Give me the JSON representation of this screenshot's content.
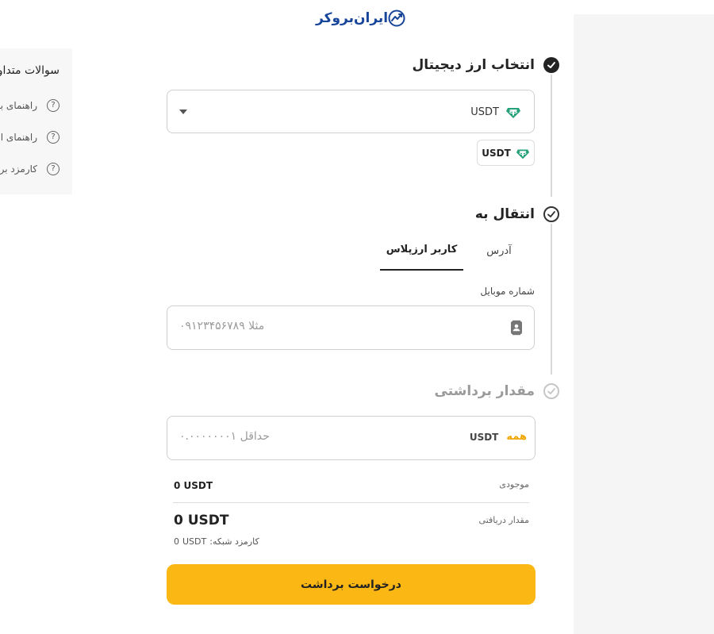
{
  "brand": {
    "logo_text": "ایران‌بروکر"
  },
  "faq": {
    "title": "سوالات متداول",
    "items": [
      {
        "label": "راهنمای برداشت ارز"
      },
      {
        "label": "راهنمای انتقال ارز"
      },
      {
        "label": "کارمزد برداشت"
      }
    ]
  },
  "steps": {
    "currency": {
      "title": "انتخاب ارز دیجیتال"
    },
    "transfer": {
      "title": "انتقال به"
    },
    "amount": {
      "title": "مقدار برداشتی"
    }
  },
  "currency_select": {
    "value": "USDT",
    "chip": "USDT"
  },
  "tabs": [
    {
      "label": "آدرس",
      "active": false
    },
    {
      "label": "کاربر ارزپلاس",
      "active": true
    }
  ],
  "phone": {
    "label": "شماره موبایل",
    "placeholder": "مثلا ۰۹۱۲۳۴۵۶۷۸۹"
  },
  "amount": {
    "all_label": "همه",
    "unit": "USDT",
    "placeholder": "حداقل ۰.۰۰۰۰۰۰۰۱"
  },
  "balance": {
    "label": "موجودی",
    "value": "0 USDT"
  },
  "received": {
    "label": "مقدار دریافتی",
    "value": "0 USDT"
  },
  "network_fee": {
    "label": "کارمزد شبکه:",
    "value": "0",
    "unit": "USDT"
  },
  "submit": {
    "label": "درخواست برداشت"
  },
  "colors": {
    "brand": "#17459a",
    "accent": "#fbb814",
    "tether": "#26a17b"
  }
}
